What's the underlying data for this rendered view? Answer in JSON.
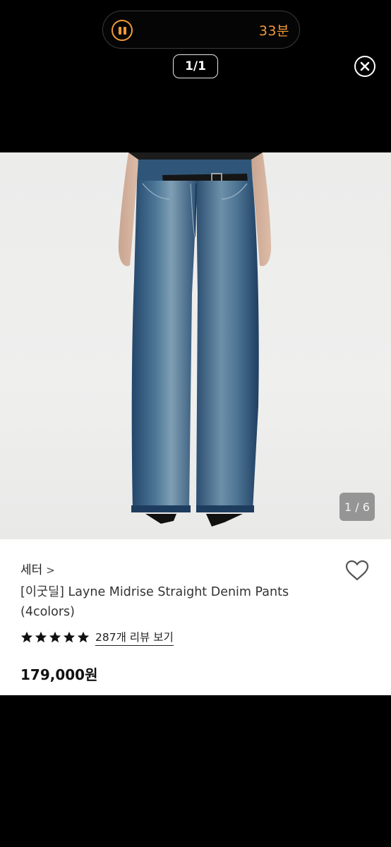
{
  "overlay": {
    "timer": "33분",
    "counter": "1/1",
    "pause_icon": "pause-icon",
    "close_icon": "close-icon"
  },
  "product": {
    "image_alt_icon": "product-photo",
    "page_indicator": "1 / 6",
    "brand": "세터",
    "brand_chevron": ">",
    "title": "[이굿딜] Layne Midrise Straight Denim Pants (4colors)",
    "rating_stars": 5,
    "review_link": "287개 리뷰 보기",
    "price": "179,000원",
    "heart_icon": "heart-icon"
  },
  "colors": {
    "accent": "#f19a38",
    "background": "#000000",
    "card": "#ffffff"
  }
}
